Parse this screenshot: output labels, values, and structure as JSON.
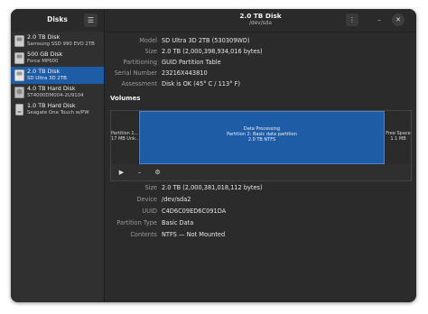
{
  "sidebar": {
    "title": "Disks",
    "menu_icon": "hamburger-icon",
    "disks": [
      {
        "name": "2.0 TB Disk",
        "sub": "Samsung SSD 990 EVO 2TB",
        "icon": "ssd-icon",
        "selected": false
      },
      {
        "name": "500 GB Disk",
        "sub": "Force MP600",
        "icon": "ssd-icon",
        "selected": false
      },
      {
        "name": "2.0 TB Disk",
        "sub": "SD Ultra 3D 2TB",
        "icon": "ssd-icon",
        "selected": true
      },
      {
        "name": "4.0 TB Hard Disk",
        "sub": "ST4000DM004-2U9104",
        "icon": "hard-disk-icon",
        "selected": false
      },
      {
        "name": "1.0 TB Hard Disk",
        "sub": "Seagate One Touch w/PW",
        "icon": "usb-drive-icon",
        "selected": false
      }
    ]
  },
  "header": {
    "title": "2.0 TB Disk",
    "subtitle": "/dev/sda",
    "menu_icon": "kebab-menu-icon",
    "minimize_glyph": "–",
    "close_glyph": "✕"
  },
  "drive_info": [
    {
      "label": "Model",
      "value": "SD Ultra 3D 2TB (530309WD)"
    },
    {
      "label": "Size",
      "value": "2.0 TB (2,000,398,934,016 bytes)"
    },
    {
      "label": "Partitioning",
      "value": "GUID Partition Table"
    },
    {
      "label": "Serial Number",
      "value": "23216X443810"
    },
    {
      "label": "Assessment",
      "value": "Disk is OK (45° C / 113° F)"
    }
  ],
  "volumes": {
    "title": "Volumes",
    "partitions": [
      {
        "line1": "Partition 1...",
        "line2": "17 MB Unk...",
        "line3": ""
      },
      {
        "line1": "Data Processing",
        "line2": "Partition 2: Basic data partition",
        "line3": "2.0 TB NTFS"
      },
      {
        "line1": "Free Space",
        "line2": "1.1 MB",
        "line3": ""
      }
    ],
    "toolbar": [
      {
        "icon": "play-icon",
        "glyph": "▶"
      },
      {
        "icon": "minus-icon",
        "glyph": "–"
      },
      {
        "icon": "gears-icon",
        "glyph": "⚙"
      }
    ]
  },
  "partition_info": [
    {
      "label": "Size",
      "value": "2.0 TB (2,000,381,018,112 bytes)"
    },
    {
      "label": "Device",
      "value": "/dev/sda2"
    },
    {
      "label": "UUID",
      "value": "C4D6C09ED6C091DA"
    },
    {
      "label": "Partition Type",
      "value": "Basic Data"
    },
    {
      "label": "Contents",
      "value": "NTFS — Not Mounted"
    }
  ],
  "colors": {
    "accent": "#1f5ca6",
    "window": "#2b2b2b",
    "sidebar": "#303030"
  }
}
